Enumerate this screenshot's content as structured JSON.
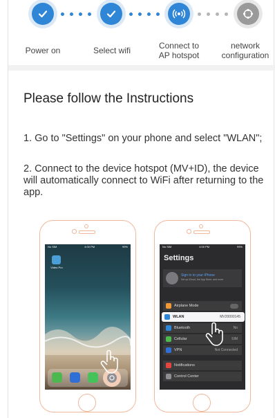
{
  "steps": [
    {
      "label": "Power on",
      "state": "done",
      "icon": "check-icon"
    },
    {
      "label": "Select wifi",
      "state": "done",
      "icon": "check-icon"
    },
    {
      "label": "Connect to\nAP hotspot",
      "state": "active",
      "icon": "hotspot-icon"
    },
    {
      "label": "network\nconfiguration",
      "state": "pending",
      "icon": "network-config-icon"
    }
  ],
  "title": "Please follow the Instructions",
  "instructions": [
    "1. Go to \"Settings\" on your phone and select \"WLAN\";",
    "2. Connect to the device hotspot (MV+ID), the device will automatically connect to WiFi after returning to the app."
  ],
  "phone_left": {
    "app_label": "Video Pro",
    "status_time": "4:00 PM",
    "status_carrier": "No SIM",
    "status_battery": "99%"
  },
  "phone_right": {
    "status_carrier": "No SIM",
    "status_time": "4:00 PM",
    "status_battery": "99%",
    "settings_title": "Settings",
    "signin_title": "Sign in to your iPhone",
    "signin_sub": "Set up iCloud, the App Store, and more.",
    "rows": [
      {
        "label": "Airplane Mode",
        "value": ""
      },
      {
        "label": "WLAN",
        "value": "MV20000145"
      },
      {
        "label": "Bluetooth",
        "value": "No"
      },
      {
        "label": "Cellular",
        "value": "SIM"
      },
      {
        "label": "VPN",
        "value": "Not Connected"
      },
      {
        "label": "Notifications",
        "value": ""
      },
      {
        "label": "Control Center",
        "value": ""
      }
    ]
  },
  "colors": {
    "accent": "#2f86d7",
    "pending": "#9a9a9a",
    "phone_outline": "#f0b79a"
  }
}
